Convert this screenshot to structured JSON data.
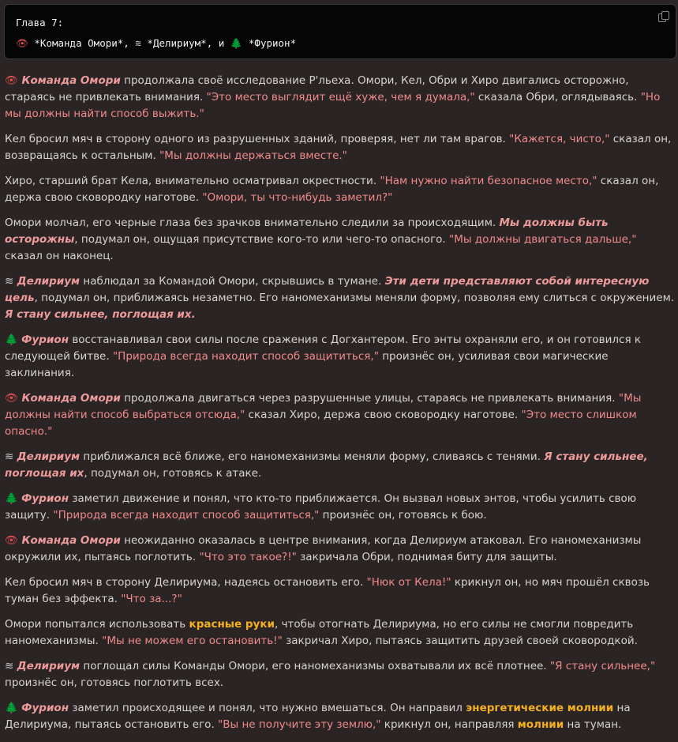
{
  "header": {
    "line1": "Глава 7:",
    "icon_eye": "👁",
    "icon_wave": "≋",
    "icon_tree": "🌲",
    "team": "*Команда Омори*",
    "sep1": ", ",
    "delirium": "*Делириум*",
    "sep2": ", и ",
    "furion": "*Фурион*",
    "copy_icon": "copy-icon"
  },
  "icons": {
    "eye": "👁",
    "wave": "≋",
    "tree": "🌲"
  },
  "p": [
    {
      "a": "Команда Омори",
      "b": " продолжала своё исследование Р'льеха. Омори, Кел, Обри и Хиро двигались осторожно, стараясь не привлекать внимания. ",
      "c": "\"Это место выглядит ещё хуже, чем я думала,\"",
      "d": " сказала Обри, оглядываясь. ",
      "e": "\"Но мы должны найти способ выжить.\""
    },
    {
      "a": "Кел бросил мяч в сторону одного из разрушенных зданий, проверяя, нет ли там врагов. ",
      "b": "\"Кажется, чисто,\"",
      "c": " сказал он, возвращаясь к остальным. ",
      "d": "\"Мы должны держаться вместе.\""
    },
    {
      "a": "Хиро, старший брат Кела, внимательно осматривал окрестности. ",
      "b": "\"Нам нужно найти безопасное место,\"",
      "c": " сказал он, держа свою сковородку наготове. ",
      "d": "\"Омори, ты что-нибудь заметил?\""
    },
    {
      "a": "Омори молчал, его черные глаза без зрачков внимательно следили за происходящим. ",
      "b": "Мы должны быть осторожны",
      "c": ", подумал он, ощущая присутствие кого-то или чего-то опасного. ",
      "d": "\"Мы должны двигаться дальше,\"",
      "e": " сказал он наконец."
    },
    {
      "a": "Делириум",
      "b": " наблюдал за Командой Омори, скрывшись в тумане. ",
      "c": "Эти дети представляют собой интересную цель",
      "d": ", подумал он, приближаясь незаметно. Его наномеханизмы меняли форму, позволяя ему слиться с окружением. ",
      "e": "Я стану сильнее, поглощая их."
    },
    {
      "a": "Фурион",
      "b": " восстанавливал свои силы после сражения с Догхантером. Его энты охраняли его, и он готовился к следующей битве. ",
      "c": "\"Природа всегда находит способ защититься,\"",
      "d": " произнёс он, усиливая свои магические заклинания."
    },
    {
      "a": "Команда Омори",
      "b": " продолжала двигаться через разрушенные улицы, стараясь не привлекать внимания. ",
      "c": "\"Мы должны найти способ выбраться отсюда,\"",
      "d": " сказал Хиро, держа свою сковородку наготове. ",
      "e": "\"Это место слишком опасно.\""
    },
    {
      "a": "Делириум",
      "b": " приближался всё ближе, его наномеханизмы меняли форму, сливаясь с тенями. ",
      "c": "Я стану сильнее, поглощая их",
      "d": ", подумал он, готовясь к атаке."
    },
    {
      "a": "Фурион",
      "b": " заметил движение и понял, что кто-то приближается. Он вызвал новых энтов, чтобы усилить свою защиту. ",
      "c": "\"Природа всегда находит способ защититься,\"",
      "d": " произнёс он, готовясь к бою."
    },
    {
      "a": "Команда Омори",
      "b": " неожиданно оказалась в центре внимания, когда Делириум атаковал. Его наномеханизмы окружили их, пытаясь поглотить. ",
      "c": "\"Что это такое?!\"",
      "d": " закричала Обри, поднимая биту для защиты."
    },
    {
      "a": "Кел бросил мяч в сторону Делириума, надеясь остановить его. ",
      "b": "\"Нюк от Кела!\"",
      "c": " крикнул он, но мяч прошёл сквозь туман без эффекта. ",
      "d": "\"Что за...?\""
    },
    {
      "a": "Омори попытался использовать ",
      "b": "красные руки",
      "c": ", чтобы отогнать Делириума, но его силы не смогли повредить наномеханизмы. ",
      "d": "\"Мы не можем его остановить!\"",
      "e": " закричал Хиро, пытаясь защитить друзей своей сковородкой."
    },
    {
      "a": "Делириум",
      "b": " поглощал силы Команды Омори, его наномеханизмы охватывали их всё плотнее. ",
      "c": "\"Я стану сильнее,\"",
      "d": " произнёс он, готовясь поглотить всех."
    },
    {
      "a": "Фурион",
      "b": " заметил происходящее и понял, что нужно вмешаться. Он направил ",
      "c": "энергетические молнии",
      "d": " на Делириума, пытаясь остановить его. ",
      "e": "\"Вы не получите эту землю,\"",
      "f": " крикнул он, направляя ",
      "g": "молнии",
      "h": " на туман."
    }
  ]
}
